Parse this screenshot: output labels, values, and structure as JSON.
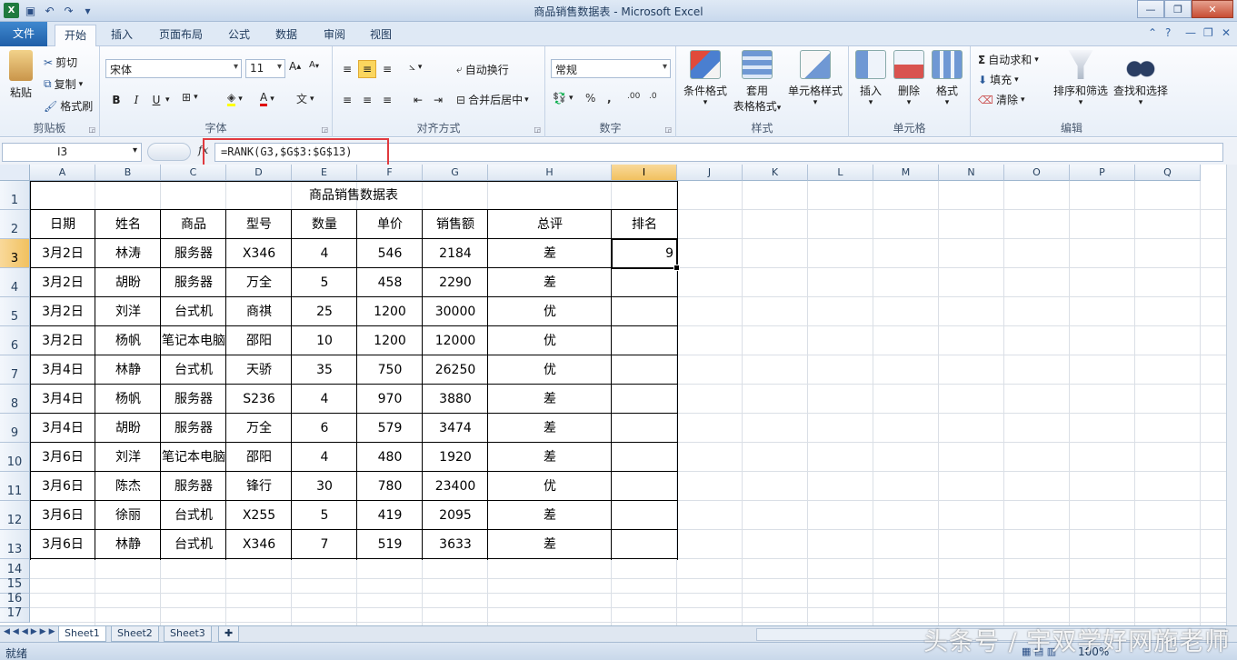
{
  "window": {
    "title": "商品销售数据表 - Microsoft Excel"
  },
  "ribbon_tabs": [
    "文件",
    "开始",
    "插入",
    "页面布局",
    "公式",
    "数据",
    "审阅",
    "视图"
  ],
  "ribbon": {
    "clipboard": {
      "paste": "粘贴",
      "cut": "剪切",
      "copy": "复制",
      "format_painter": "格式刷",
      "label": "剪贴板"
    },
    "font": {
      "name": "宋体",
      "size": "11",
      "label": "字体",
      "bold": "B",
      "italic": "I",
      "underline": "U"
    },
    "alignment": {
      "wrap": "自动换行",
      "merge": "合并后居中",
      "label": "对齐方式"
    },
    "number": {
      "format": "常规",
      "label": "数字"
    },
    "styles": {
      "conditional": "条件格式",
      "table_format_1": "套用",
      "table_format_2": "表格格式",
      "cell_styles": "单元格样式",
      "label": "样式"
    },
    "cells": {
      "insert": "插入",
      "delete": "删除",
      "format": "格式",
      "label": "单元格"
    },
    "editing": {
      "autosum": "自动求和",
      "fill": "填充",
      "clear": "清除",
      "sort_filter": "排序和筛选",
      "find_select": "查找和选择",
      "label": "编辑"
    }
  },
  "formula_bar": {
    "name_box": "I3",
    "fx": "fx",
    "formula": "=RANK(G3,$G$3:$G$13)"
  },
  "columns": [
    "A",
    "B",
    "C",
    "D",
    "E",
    "F",
    "G",
    "H",
    "I",
    "J",
    "K",
    "L",
    "M",
    "N",
    "O",
    "P",
    "Q"
  ],
  "rows": [
    "1",
    "2",
    "3",
    "4",
    "5",
    "6",
    "7",
    "8",
    "9",
    "10",
    "11",
    "12",
    "13",
    "14",
    "15",
    "16",
    "17"
  ],
  "sheet": {
    "title": "商品销售数据表",
    "headers": [
      "日期",
      "姓名",
      "商品",
      "型号",
      "数量",
      "单价",
      "销售额",
      "总评",
      "排名"
    ],
    "data": [
      [
        "3月2日",
        "林涛",
        "服务器",
        "X346",
        "4",
        "546",
        "2184",
        "差",
        "9"
      ],
      [
        "3月2日",
        "胡盼",
        "服务器",
        "万全",
        "5",
        "458",
        "2290",
        "差",
        ""
      ],
      [
        "3月2日",
        "刘洋",
        "台式机",
        "商祺",
        "25",
        "1200",
        "30000",
        "优",
        ""
      ],
      [
        "3月2日",
        "杨帆",
        "笔记本电脑",
        "邵阳",
        "10",
        "1200",
        "12000",
        "优",
        ""
      ],
      [
        "3月4日",
        "林静",
        "台式机",
        "天骄",
        "35",
        "750",
        "26250",
        "优",
        ""
      ],
      [
        "3月4日",
        "杨帆",
        "服务器",
        "S236",
        "4",
        "970",
        "3880",
        "差",
        ""
      ],
      [
        "3月4日",
        "胡盼",
        "服务器",
        "万全",
        "6",
        "579",
        "3474",
        "差",
        ""
      ],
      [
        "3月6日",
        "刘洋",
        "笔记本电脑",
        "邵阳",
        "4",
        "480",
        "1920",
        "差",
        ""
      ],
      [
        "3月6日",
        "陈杰",
        "服务器",
        "锋行",
        "30",
        "780",
        "23400",
        "优",
        ""
      ],
      [
        "3月6日",
        "徐丽",
        "台式机",
        "X255",
        "5",
        "419",
        "2095",
        "差",
        ""
      ],
      [
        "3月6日",
        "林静",
        "台式机",
        "X346",
        "7",
        "519",
        "3633",
        "差",
        ""
      ]
    ]
  },
  "sheet_tabs": [
    "Sheet1",
    "Sheet2",
    "Sheet3"
  ],
  "status": {
    "text": "就绪",
    "zoom": "100%"
  },
  "watermark": "头条号 / 宇双学好网施老师",
  "colors": {
    "accent": "#1f5fa8",
    "highlight_box": "#e0393e",
    "active_header": "#f1c15f"
  }
}
